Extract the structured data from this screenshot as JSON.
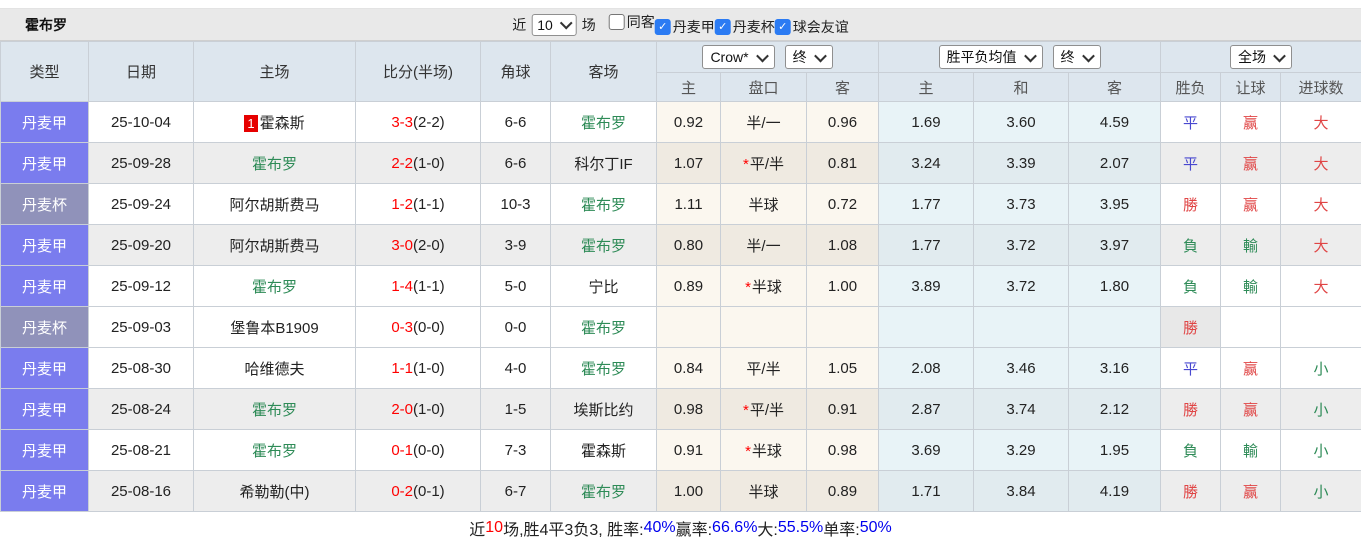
{
  "title": "霍布罗",
  "toolbar": {
    "recent_label": "近",
    "recent_count": "10",
    "unit_label": "场",
    "checkboxes": [
      {
        "label": "同客",
        "checked": false
      },
      {
        "label": "丹麦甲",
        "checked": true
      },
      {
        "label": "丹麦杯",
        "checked": true
      },
      {
        "label": "球会友谊",
        "checked": true
      }
    ]
  },
  "table": {
    "base_columns": [
      "类型",
      "日期",
      "主场",
      "比分(半场)",
      "角球",
      "客场"
    ],
    "odds_group": {
      "company": "Crow*",
      "time": "终",
      "sub": [
        "主",
        "盘口",
        "客"
      ]
    },
    "avg_group": {
      "company": "胜平负均值",
      "time": "终",
      "sub": [
        "主",
        "和",
        "客"
      ]
    },
    "result_group": {
      "scope": "全场",
      "sub": [
        "胜负",
        "让球",
        "进球数"
      ]
    },
    "rows": [
      {
        "type": "丹麦甲",
        "date": "25-10-04",
        "home": "霍森斯",
        "home_badge": "1",
        "home_style": "dark",
        "score_ft": "3-3",
        "score_ht": "(2-2)",
        "corners": "6-6",
        "away": "霍布罗",
        "away_style": "green",
        "odds_home": "0.92",
        "handicap": "半/一",
        "handicap_star": false,
        "odds_away": "0.96",
        "avg_home": "1.69",
        "avg_draw": "3.60",
        "avg_away": "4.59",
        "res_wdl": "平",
        "res_wdl_color": "blue",
        "res_handicap": "赢",
        "res_handicap_color": "red",
        "res_goals": "大",
        "res_goals_color": "red"
      },
      {
        "type": "丹麦甲",
        "date": "25-09-28",
        "home": "霍布罗",
        "home_badge": "",
        "home_style": "green",
        "score_ft": "2-2",
        "score_ht": "(1-0)",
        "corners": "6-6",
        "away": "科尔丁IF",
        "away_style": "dark",
        "odds_home": "1.07",
        "handicap": "平/半",
        "handicap_star": true,
        "odds_away": "0.81",
        "avg_home": "3.24",
        "avg_draw": "3.39",
        "avg_away": "2.07",
        "res_wdl": "平",
        "res_wdl_color": "blue",
        "res_handicap": "赢",
        "res_handicap_color": "red",
        "res_goals": "大",
        "res_goals_color": "red"
      },
      {
        "type": "丹麦杯",
        "date": "25-09-24",
        "home": "阿尔胡斯费马",
        "home_badge": "",
        "home_style": "dark",
        "score_ft": "1-2",
        "score_ht": "(1-1)",
        "corners": "10-3",
        "away": "霍布罗",
        "away_style": "green",
        "odds_home": "1.11",
        "handicap": "半球",
        "handicap_star": false,
        "odds_away": "0.72",
        "avg_home": "1.77",
        "avg_draw": "3.73",
        "avg_away": "3.95",
        "res_wdl": "勝",
        "res_wdl_color": "red",
        "res_handicap": "赢",
        "res_handicap_color": "red",
        "res_goals": "大",
        "res_goals_color": "red"
      },
      {
        "type": "丹麦甲",
        "date": "25-09-20",
        "home": "阿尔胡斯费马",
        "home_badge": "",
        "home_style": "dark",
        "score_ft": "3-0",
        "score_ht": "(2-0)",
        "corners": "3-9",
        "away": "霍布罗",
        "away_style": "green",
        "odds_home": "0.80",
        "handicap": "半/一",
        "handicap_star": false,
        "odds_away": "1.08",
        "avg_home": "1.77",
        "avg_draw": "3.72",
        "avg_away": "3.97",
        "res_wdl": "負",
        "res_wdl_color": "green",
        "res_handicap": "輸",
        "res_handicap_color": "green",
        "res_goals": "大",
        "res_goals_color": "red"
      },
      {
        "type": "丹麦甲",
        "date": "25-09-12",
        "home": "霍布罗",
        "home_badge": "",
        "home_style": "green",
        "score_ft": "1-4",
        "score_ht": "(1-1)",
        "corners": "5-0",
        "away": "宁比",
        "away_style": "dark",
        "odds_home": "0.89",
        "handicap": "半球",
        "handicap_star": true,
        "odds_away": "1.00",
        "avg_home": "3.89",
        "avg_draw": "3.72",
        "avg_away": "1.80",
        "res_wdl": "負",
        "res_wdl_color": "green",
        "res_handicap": "輸",
        "res_handicap_color": "green",
        "res_goals": "大",
        "res_goals_color": "red"
      },
      {
        "type": "丹麦杯",
        "date": "25-09-03",
        "home": "堡鲁本B1909",
        "home_badge": "",
        "home_style": "dark",
        "score_ft": "0-3",
        "score_ht": "(0-0)",
        "corners": "0-0",
        "away": "霍布罗",
        "away_style": "green",
        "odds_home": "",
        "handicap": "",
        "handicap_star": false,
        "odds_away": "",
        "avg_home": "",
        "avg_draw": "",
        "avg_away": "",
        "res_wdl": "勝",
        "res_wdl_color": "red",
        "res_handicap": "",
        "res_handicap_color": "dark",
        "res_goals": "",
        "res_goals_color": "dark"
      },
      {
        "type": "丹麦甲",
        "date": "25-08-30",
        "home": "哈维德夫",
        "home_badge": "",
        "home_style": "dark",
        "score_ft": "1-1",
        "score_ht": "(1-0)",
        "corners": "4-0",
        "away": "霍布罗",
        "away_style": "green",
        "odds_home": "0.84",
        "handicap": "平/半",
        "handicap_star": false,
        "odds_away": "1.05",
        "avg_home": "2.08",
        "avg_draw": "3.46",
        "avg_away": "3.16",
        "res_wdl": "平",
        "res_wdl_color": "blue",
        "res_handicap": "赢",
        "res_handicap_color": "red",
        "res_goals": "小",
        "res_goals_color": "green"
      },
      {
        "type": "丹麦甲",
        "date": "25-08-24",
        "home": "霍布罗",
        "home_badge": "",
        "home_style": "green",
        "score_ft": "2-0",
        "score_ht": "(1-0)",
        "corners": "1-5",
        "away": "埃斯比约",
        "away_style": "dark",
        "odds_home": "0.98",
        "handicap": "平/半",
        "handicap_star": true,
        "odds_away": "0.91",
        "avg_home": "2.87",
        "avg_draw": "3.74",
        "avg_away": "2.12",
        "res_wdl": "勝",
        "res_wdl_color": "red",
        "res_handicap": "赢",
        "res_handicap_color": "red",
        "res_goals": "小",
        "res_goals_color": "green"
      },
      {
        "type": "丹麦甲",
        "date": "25-08-21",
        "home": "霍布罗",
        "home_badge": "",
        "home_style": "green",
        "score_ft": "0-1",
        "score_ht": "(0-0)",
        "corners": "7-3",
        "away": "霍森斯",
        "away_style": "dark",
        "odds_home": "0.91",
        "handicap": "半球",
        "handicap_star": true,
        "odds_away": "0.98",
        "avg_home": "3.69",
        "avg_draw": "3.29",
        "avg_away": "1.95",
        "res_wdl": "負",
        "res_wdl_color": "green",
        "res_handicap": "輸",
        "res_handicap_color": "green",
        "res_goals": "小",
        "res_goals_color": "green"
      },
      {
        "type": "丹麦甲",
        "date": "25-08-16",
        "home": "希勒勒(中)",
        "home_badge": "",
        "home_style": "dark",
        "score_ft": "0-2",
        "score_ht": "(0-1)",
        "corners": "6-7",
        "away": "霍布罗",
        "away_style": "green",
        "odds_home": "1.00",
        "handicap": "半球",
        "handicap_star": false,
        "odds_away": "0.89",
        "avg_home": "1.71",
        "avg_draw": "3.84",
        "avg_away": "4.19",
        "res_wdl": "勝",
        "res_wdl_color": "red",
        "res_handicap": "赢",
        "res_handicap_color": "red",
        "res_goals": "小",
        "res_goals_color": "green"
      }
    ]
  },
  "footer": {
    "segments": [
      {
        "text": "近",
        "color": "dark"
      },
      {
        "text": "10",
        "color": "red"
      },
      {
        "text": "场,胜4平3负3, 胜率:",
        "color": "dark"
      },
      {
        "text": "40%",
        "color": "blue"
      },
      {
        "text": " 赢率:",
        "color": "dark"
      },
      {
        "text": "66.6%",
        "color": "blue"
      },
      {
        "text": " 大:",
        "color": "dark"
      },
      {
        "text": "55.5%",
        "color": "blue"
      },
      {
        "text": " 单率:",
        "color": "dark"
      },
      {
        "text": "50%",
        "color": "blue"
      }
    ]
  }
}
